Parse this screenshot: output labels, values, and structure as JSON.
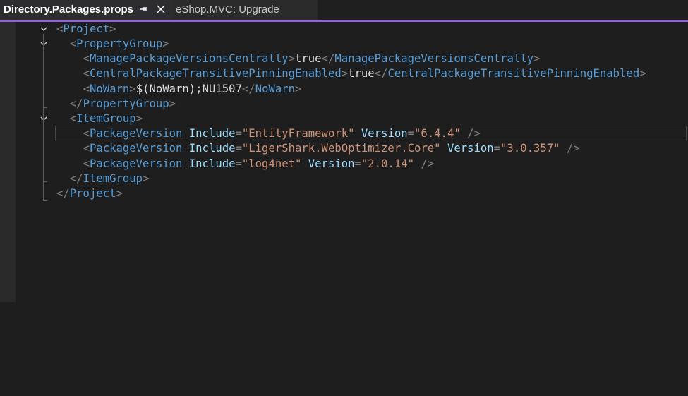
{
  "tabs": [
    {
      "label": "Directory.Packages.props",
      "active": true,
      "pinned": true
    },
    {
      "label": "eShop.MVC: Upgrade",
      "active": false
    }
  ],
  "colors": {
    "background": "#1e1e1e",
    "tab_accent": "#8f64d0",
    "tag": "#569cd6",
    "attribute": "#9cdcfe",
    "string": "#ce9178",
    "delimiter": "#808080",
    "text": "#dcdcdc"
  },
  "code": {
    "project_tag": "Project",
    "property_group_tag": "PropertyGroup",
    "manage_tag": "ManagePackageVersionsCentrally",
    "manage_value": "true",
    "pinning_tag": "CentralPackageTransitivePinningEnabled",
    "pinning_value": "true",
    "nowarn_tag": "NoWarn",
    "nowarn_value": "$(NoWarn);NU1507",
    "item_group_tag": "ItemGroup",
    "package_version_tag": "PackageVersion",
    "include_attr": "Include",
    "version_attr": "Version",
    "packages": [
      {
        "include": "\"EntityFramework\"",
        "version": "\"6.4.4\""
      },
      {
        "include": "\"LigerShark.WebOptimizer.Core\"",
        "version": "\"3.0.357\""
      },
      {
        "include": "\"log4net\"",
        "version": "\"2.0.14\""
      }
    ]
  }
}
